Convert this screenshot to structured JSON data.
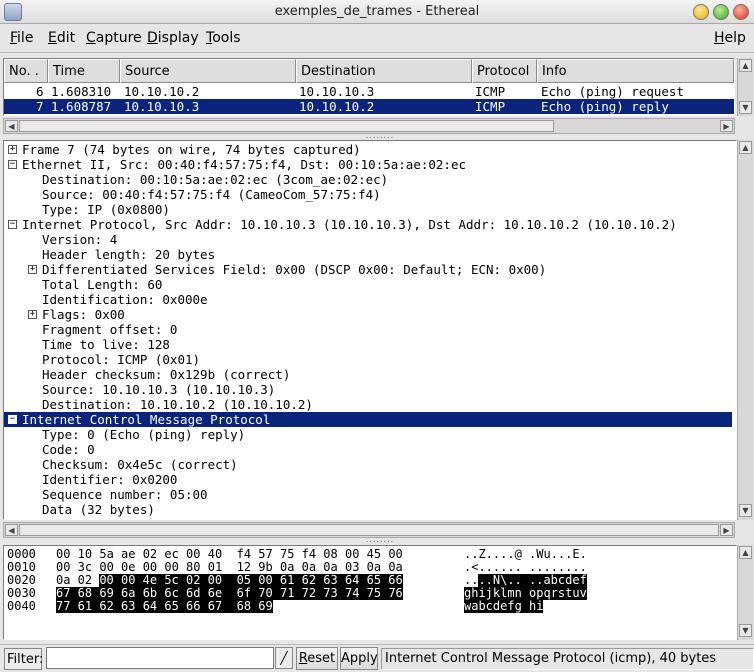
{
  "window": {
    "title": "exemples_de_trames - Ethereal"
  },
  "menu": [
    {
      "label": "File",
      "key": "F",
      "rest": "ile"
    },
    {
      "label": "Edit",
      "key": "E",
      "rest": "dit"
    },
    {
      "label": "Capture",
      "key": "C",
      "rest": "apture"
    },
    {
      "label": "Display",
      "key": "D",
      "rest": "isplay"
    },
    {
      "label": "Tools",
      "key": "T",
      "rest": "ools"
    },
    {
      "label": "Help",
      "key": "H",
      "rest": "elp"
    }
  ],
  "packet_list": {
    "columns": [
      "No. .",
      "Time",
      "Source",
      "Destination",
      "Protocol",
      "Info"
    ],
    "rows": [
      {
        "no": "6",
        "time": "1.608310",
        "source": "10.10.10.2",
        "destination": "10.10.10.3",
        "protocol": "ICMP",
        "info": "Echo (ping) request",
        "selected": false
      },
      {
        "no": "7",
        "time": "1.608787",
        "source": "10.10.10.3",
        "destination": "10.10.10.2",
        "protocol": "ICMP",
        "info": "Echo (ping) reply",
        "selected": true
      }
    ]
  },
  "tree": [
    {
      "expander": "+",
      "text": "Frame 7 (74 bytes on wire, 74 bytes captured)"
    },
    {
      "expander": "−",
      "text": "Ethernet II, Src: 00:40:f4:57:75:f4, Dst: 00:10:5a:ae:02:ec"
    },
    {
      "expander": "",
      "text": "Destination: 00:10:5a:ae:02:ec (3com_ae:02:ec)"
    },
    {
      "expander": "",
      "text": "Source: 00:40:f4:57:75:f4 (CameoCom_57:75:f4)"
    },
    {
      "expander": "",
      "text": "Type: IP (0x0800)"
    },
    {
      "expander": "−",
      "text": "Internet Protocol, Src Addr: 10.10.10.3 (10.10.10.3), Dst Addr: 10.10.10.2 (10.10.10.2)"
    },
    {
      "expander": "",
      "text": "Version: 4"
    },
    {
      "expander": "",
      "text": "Header length: 20 bytes"
    },
    {
      "expander": "+",
      "text": "Differentiated Services Field: 0x00 (DSCP 0x00: Default; ECN: 0x00)"
    },
    {
      "expander": "",
      "text": "Total Length: 60"
    },
    {
      "expander": "",
      "text": "Identification: 0x000e"
    },
    {
      "expander": "+",
      "text": "Flags: 0x00"
    },
    {
      "expander": "",
      "text": "Fragment offset: 0"
    },
    {
      "expander": "",
      "text": "Time to live: 128"
    },
    {
      "expander": "",
      "text": "Protocol: ICMP (0x01)"
    },
    {
      "expander": "",
      "text": "Header checksum: 0x129b (correct)"
    },
    {
      "expander": "",
      "text": "Source: 10.10.10.3 (10.10.10.3)"
    },
    {
      "expander": "",
      "text": "Destination: 10.10.10.2 (10.10.10.2)"
    },
    {
      "expander": "−",
      "text": "Internet Control Message Protocol",
      "selected": true
    },
    {
      "expander": "",
      "text": "Type: 0 (Echo (ping) reply)"
    },
    {
      "expander": "",
      "text": "Code: 0"
    },
    {
      "expander": "",
      "text": "Checksum: 0x4e5c (correct)"
    },
    {
      "expander": "",
      "text": "Identifier: 0x0200"
    },
    {
      "expander": "",
      "text": "Sequence number: 05:00"
    },
    {
      "expander": "",
      "text": "Data (32 bytes)"
    }
  ],
  "hex_dump": [
    {
      "offset": "0000",
      "hex_plain": "00 10 5a ae 02 ec 00 40  f4 57 75 f4 08 00 45 00",
      "hex_hl": "",
      "hex_after": "",
      "ascii_plain": "..Z....@ .Wu...E.",
      "ascii_hl": "",
      "ascii_after": ""
    },
    {
      "offset": "0010",
      "hex_plain": "00 3c 00 0e 00 00 80 01  12 9b 0a 0a 0a 03 0a 0a",
      "hex_hl": "",
      "hex_after": "",
      "ascii_plain": ".<...... ........",
      "ascii_hl": "",
      "ascii_after": ""
    },
    {
      "offset": "0020",
      "hex_plain": "0a 02 ",
      "hex_hl": "00 00 4e 5c 02 00  05 00 61 62 63 64 65 66",
      "hex_after": "",
      "ascii_plain": "..",
      "ascii_hl": "..N\\.. ..abcdef",
      "ascii_after": ""
    },
    {
      "offset": "0030",
      "hex_plain": "",
      "hex_hl": "67 68 69 6a 6b 6c 6d 6e  6f 70 71 72 73 74 75 76",
      "hex_after": "",
      "ascii_plain": "",
      "ascii_hl": "ghijklmn opqrstuv",
      "ascii_after": ""
    },
    {
      "offset": "0040",
      "hex_plain": "",
      "hex_hl": "77 61 62 63 64 65 66 67  68 69",
      "hex_after": "",
      "ascii_plain": "",
      "ascii_hl": "wabcdefg hi",
      "ascii_after": ""
    }
  ],
  "statusbar": {
    "filter_label": "Filter:",
    "filter_value": "",
    "reset_label": "Reset",
    "reset_key": "R",
    "reset_rest": "eset",
    "apply_label": "Apply",
    "status_text": "Internet Control Message Protocol (icmp), 40 bytes"
  },
  "colors": {
    "selection": "#0a247c",
    "hex_highlight": "#000000"
  }
}
